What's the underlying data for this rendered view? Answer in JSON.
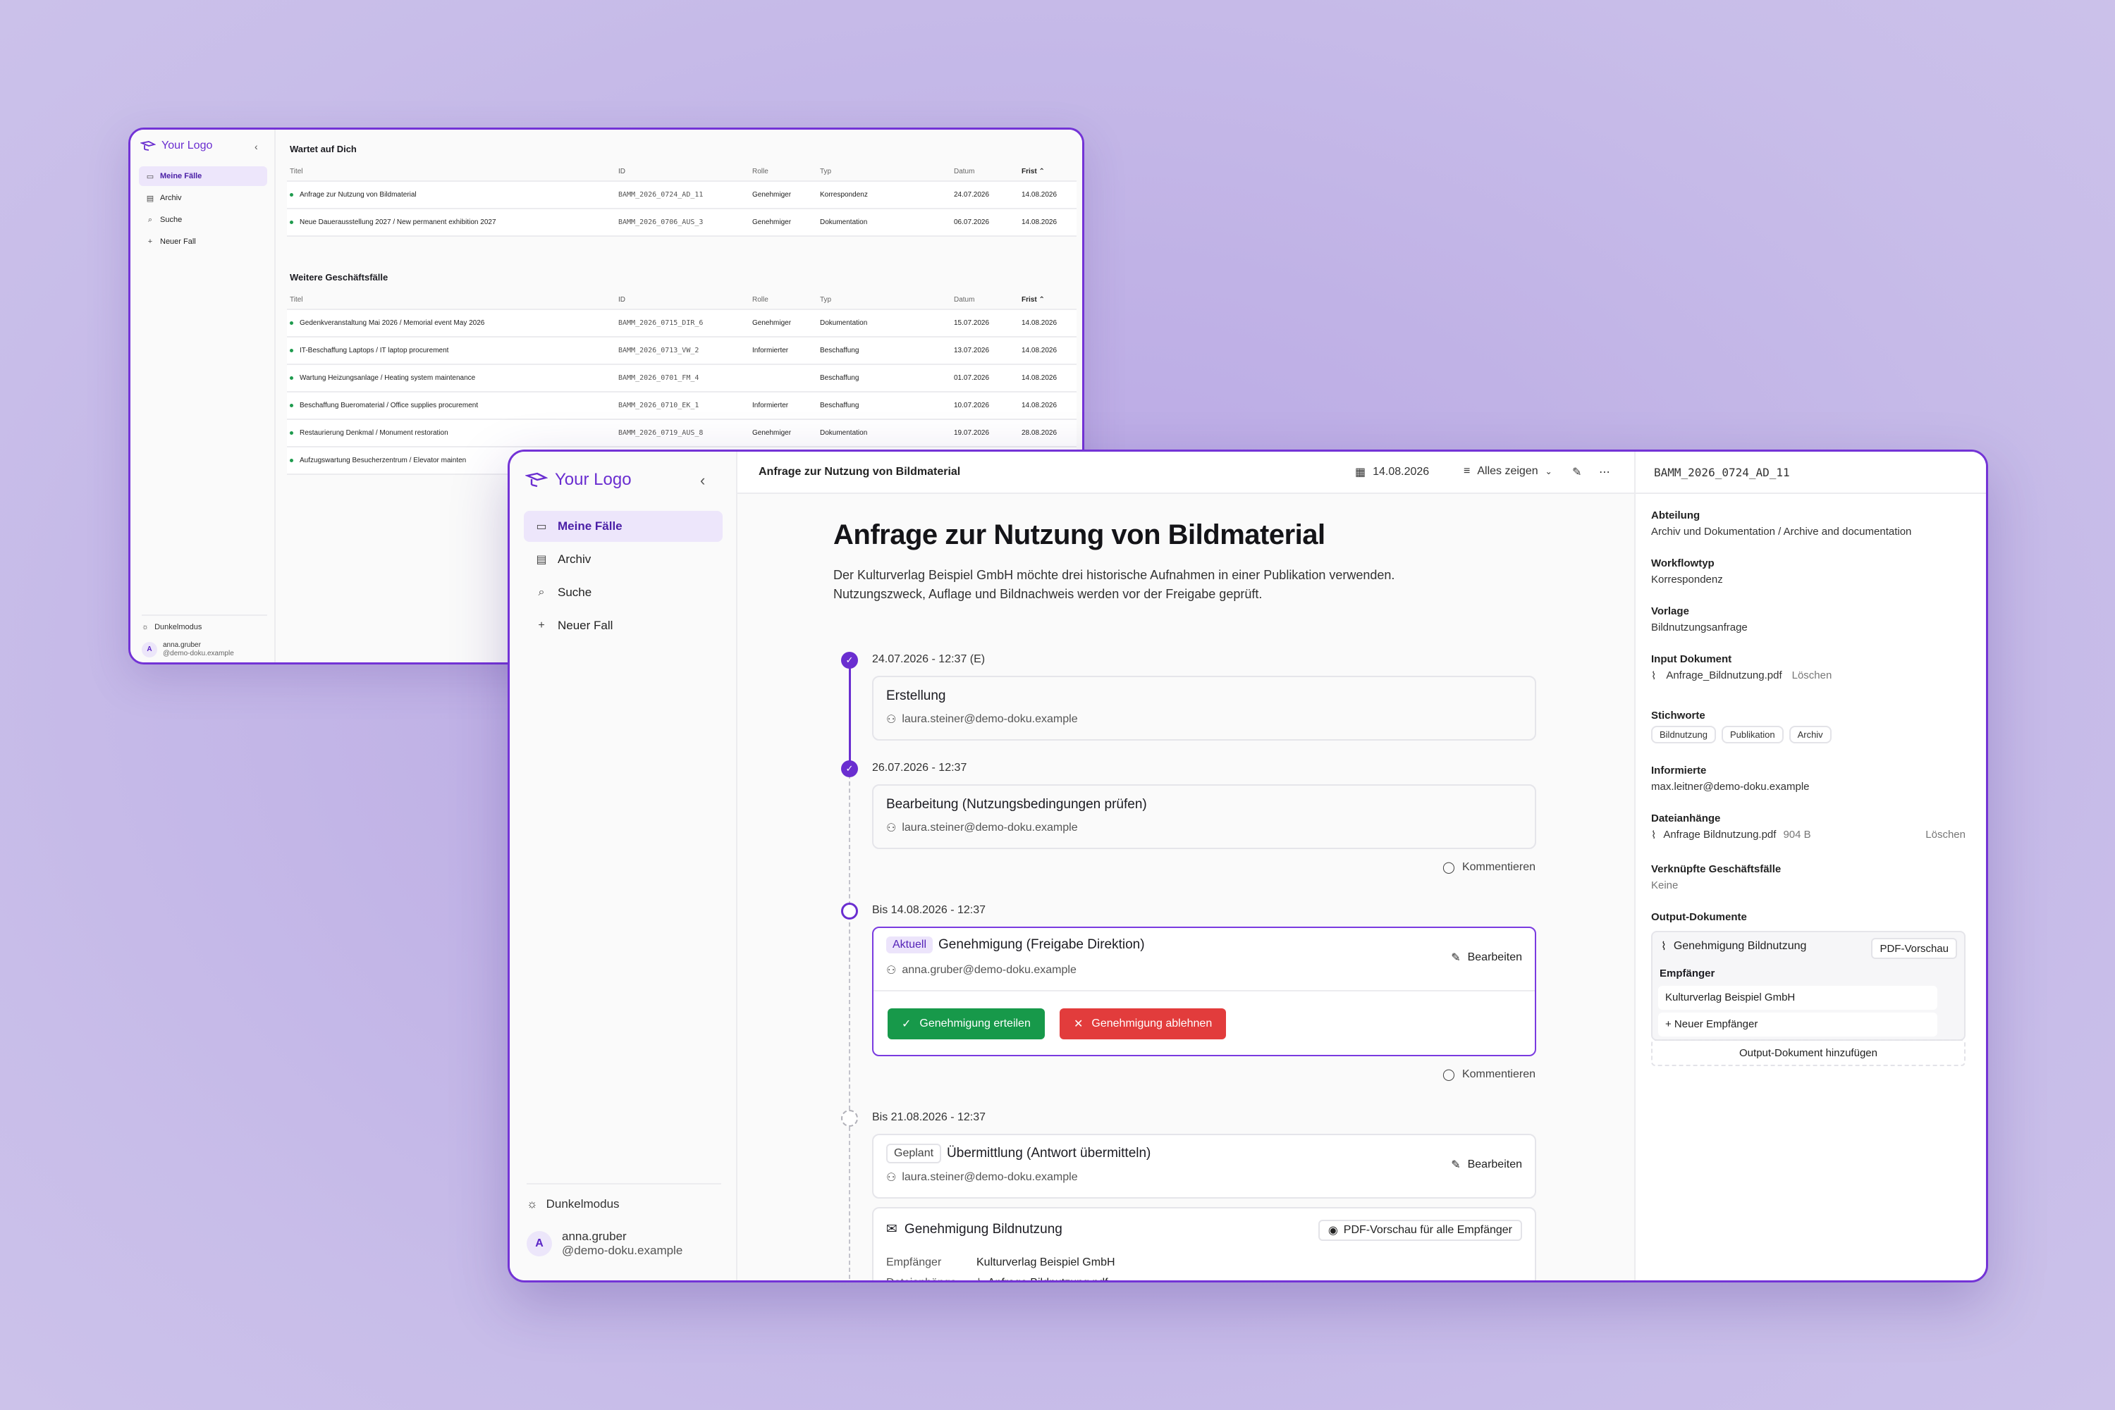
{
  "logo": "Your Logo",
  "nav": [
    "Meine Fälle",
    "Archiv",
    "Suche",
    "Neuer Fall"
  ],
  "footer": {
    "dark_mode": "Dunkelmodus",
    "avatar": "A",
    "user_name": "anna.gruber",
    "user_email": "@demo-doku.example"
  },
  "list": {
    "section1": "Wartet auf Dich",
    "section2": "Weitere Geschäftsfälle",
    "cols": {
      "title": "Titel",
      "id": "ID",
      "role": "Rolle",
      "type": "Typ",
      "date": "Datum",
      "frist": "Frist ⌃"
    },
    "rows1": [
      {
        "title": "Anfrage zur Nutzung von Bildmaterial",
        "id": "BAMM_2026_0724_AD_11",
        "role": "Genehmiger",
        "type": "Korrespondenz",
        "date": "24.07.2026",
        "frist": "14.08.2026"
      },
      {
        "title": "Neue Dauerausstellung 2027 / New permanent exhibition 2027",
        "id": "BAMM_2026_0706_AUS_3",
        "role": "Genehmiger",
        "type": "Dokumentation",
        "date": "06.07.2026",
        "frist": "14.08.2026"
      }
    ],
    "rows2": [
      {
        "title": "Gedenkveranstaltung Mai 2026 / Memorial event May 2026",
        "id": "BAMM_2026_0715_DIR_6",
        "role": "Genehmiger",
        "type": "Dokumentation",
        "date": "15.07.2026",
        "frist": "14.08.2026"
      },
      {
        "title": "IT-Beschaffung Laptops / IT laptop procurement",
        "id": "BAMM_2026_0713_VW_2",
        "role": "Informierter",
        "type": "Beschaffung",
        "date": "13.07.2026",
        "frist": "14.08.2026"
      },
      {
        "title": "Wartung Heizungsanlage / Heating system maintenance",
        "id": "BAMM_2026_0701_FM_4",
        "role": "",
        "type": "Beschaffung",
        "date": "01.07.2026",
        "frist": "14.08.2026"
      },
      {
        "title": "Beschaffung Bueromaterial / Office supplies procurement",
        "id": "BAMM_2026_0710_EK_1",
        "role": "Informierter",
        "type": "Beschaffung",
        "date": "10.07.2026",
        "frist": "14.08.2026"
      },
      {
        "title": "Restaurierung Denkmal / Monument restoration",
        "id": "BAMM_2026_0719_AUS_8",
        "role": "Genehmiger",
        "type": "Dokumentation",
        "date": "19.07.2026",
        "frist": "28.08.2026"
      },
      {
        "title": "Aufzugswartung Besucherzentrum / Elevator mainten",
        "id": "",
        "role": "",
        "type": "",
        "date": "",
        "frist": ""
      }
    ]
  },
  "detail": {
    "breadcrumb": "Anfrage zur Nutzung von Bildmaterial",
    "toolbar_date": "14.08.2026",
    "toolbar_filter": "Alles zeigen",
    "title": "Anfrage zur Nutzung von Bildmaterial",
    "description": "Der Kulturverlag Beispiel GmbH möchte drei historische Aufnahmen in einer Publikation verwenden. Nutzungszweck, Auflage und Bildnachweis werden vor der Freigabe geprüft.",
    "step1": {
      "date": "24.07.2026 - 12:37 (E)",
      "title": "Erstellung",
      "user": "laura.steiner@demo-doku.example"
    },
    "step2": {
      "date": "26.07.2026 - 12:37",
      "title": "Bearbeitung (Nutzungsbedingungen prüfen)",
      "user": "laura.steiner@demo-doku.example",
      "comment": "Kommentieren"
    },
    "step3": {
      "date": "Bis 14.08.2026 - 12:37",
      "badge": "Aktuell",
      "title": "Genehmigung (Freigabe Direktion)",
      "user": "anna.gruber@demo-doku.example",
      "edit": "Bearbeiten",
      "approve": "Genehmigung erteilen",
      "reject": "Genehmigung ablehnen",
      "comment": "Kommentieren"
    },
    "step4": {
      "date": "Bis 21.08.2026 - 12:37",
      "badge": "Geplant",
      "title": "Übermittlung (Antwort übermitteln)",
      "user": "laura.steiner@demo-doku.example",
      "edit": "Bearbeiten"
    },
    "doc": {
      "title": "Genehmigung Bildnutzung",
      "pdf_all": "PDF-Vorschau für alle Empfänger",
      "recipient_label": "Empfänger",
      "recipient": "Kulturverlag Beispiel GmbH",
      "attach_label": "Dateianhänge",
      "attach": "Anfrage Bildnutzung.pdf"
    }
  },
  "meta": {
    "case_id": "BAMM_2026_0724_AD_11",
    "abteilung_label": "Abteilung",
    "abteilung": "Archiv und Dokumentation / Archive and documentation",
    "workflow_label": "Workflowtyp",
    "workflow": "Korrespondenz",
    "vorlage_label": "Vorlage",
    "vorlage": "Bildnutzungsanfrage",
    "input_label": "Input Dokument",
    "input_file": "Anfrage_Bildnutzung.pdf",
    "delete": "Löschen",
    "tags_label": "Stichworte",
    "tags": [
      "Bildnutzung",
      "Publikation",
      "Archiv"
    ],
    "informed_label": "Informierte",
    "informed": "max.leitner@demo-doku.example",
    "attachments_label": "Dateianhänge",
    "attachment_file": "Anfrage Bildnutzung.pdf",
    "attachment_size": "904 B",
    "linked_label": "Verknüpfte Geschäftsfälle",
    "linked": "Keine",
    "output_label": "Output-Dokumente",
    "output_doc": "Genehmigung Bildnutzung",
    "pdf_preview": "PDF-Vorschau",
    "recipients_label": "Empfänger",
    "recipient1": "Kulturverlag Beispiel GmbH",
    "new_recipient": "+ Neuer Empfänger",
    "add_output": "Output-Dokument hinzufügen"
  },
  "colors": {
    "accent": "#6a2ed0",
    "approve": "#17994a",
    "reject": "#e23c3c",
    "status_dot": "#1f9b4e"
  }
}
